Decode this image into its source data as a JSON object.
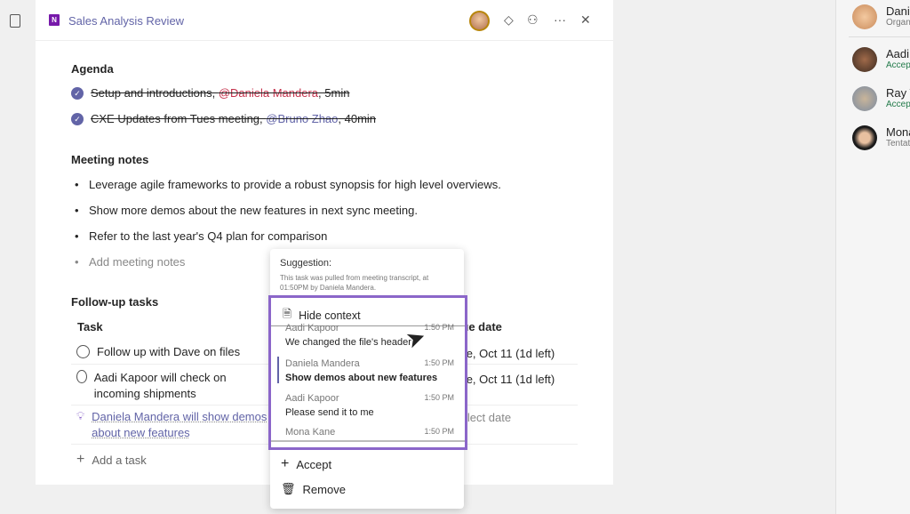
{
  "header": {
    "title": "Sales Analysis Review",
    "app_icon": "N"
  },
  "agenda": {
    "heading": "Agenda",
    "items": [
      {
        "text": "Setup and introductions, ",
        "mention": "@Daniela Mandera",
        "suffix": ", 5min"
      },
      {
        "text": "CXE Updates from Tues meeting, ",
        "mention": "@Bruno Zhao",
        "suffix": ", 40min"
      }
    ]
  },
  "notes": {
    "heading": "Meeting notes",
    "items": [
      "Leverage agile frameworks to provide a robust synopsis for high level overviews.",
      "Show more demos about the new features in next sync meeting.",
      "Refer to the last year's Q4 plan for comparison"
    ],
    "placeholder": "Add meeting notes"
  },
  "tasks": {
    "heading": "Follow-up tasks",
    "col_task": "Task",
    "col_date": "Due date",
    "rows": [
      {
        "task": "Follow up with Dave on files",
        "date": "Tue, Oct 11 (1d left)"
      },
      {
        "task": "Aadi Kapoor will check on incoming shipments",
        "date": "Tue, Oct 11 (1d left)"
      },
      {
        "task": "Daniela Mandera will show demos about new features",
        "date": "Select date"
      }
    ],
    "add": "Add a task"
  },
  "suggestion": {
    "label": "Suggestion:",
    "desc": "This task was pulled from meeting transcript, at 01:50PM by Daniela Mandera.",
    "hide": "Hide context",
    "accept": "Accept",
    "remove": "Remove",
    "messages": [
      {
        "name": "Aadi Kapoor",
        "time": "1:50 PM",
        "text": "We changed the file's header"
      },
      {
        "name": "Daniela Mandera",
        "time": "1:50 PM",
        "text": "Show demos about new features"
      },
      {
        "name": "Aadi Kapoor",
        "time": "1:50 PM",
        "text": "Please send it to me"
      },
      {
        "name": "Mona Kane",
        "time": "1:50 PM",
        "text": ""
      }
    ]
  },
  "participants": [
    {
      "name": "Daniela",
      "status": "Organizer"
    },
    {
      "name": "Aadi",
      "status": "Accepted"
    },
    {
      "name": "Ray T",
      "status": "Accepted"
    },
    {
      "name": "Mona",
      "status": "Tentative"
    }
  ],
  "colors": {
    "accent": "#6264a7",
    "highlight": "#8b66c9",
    "accepted": "#237b4b"
  }
}
